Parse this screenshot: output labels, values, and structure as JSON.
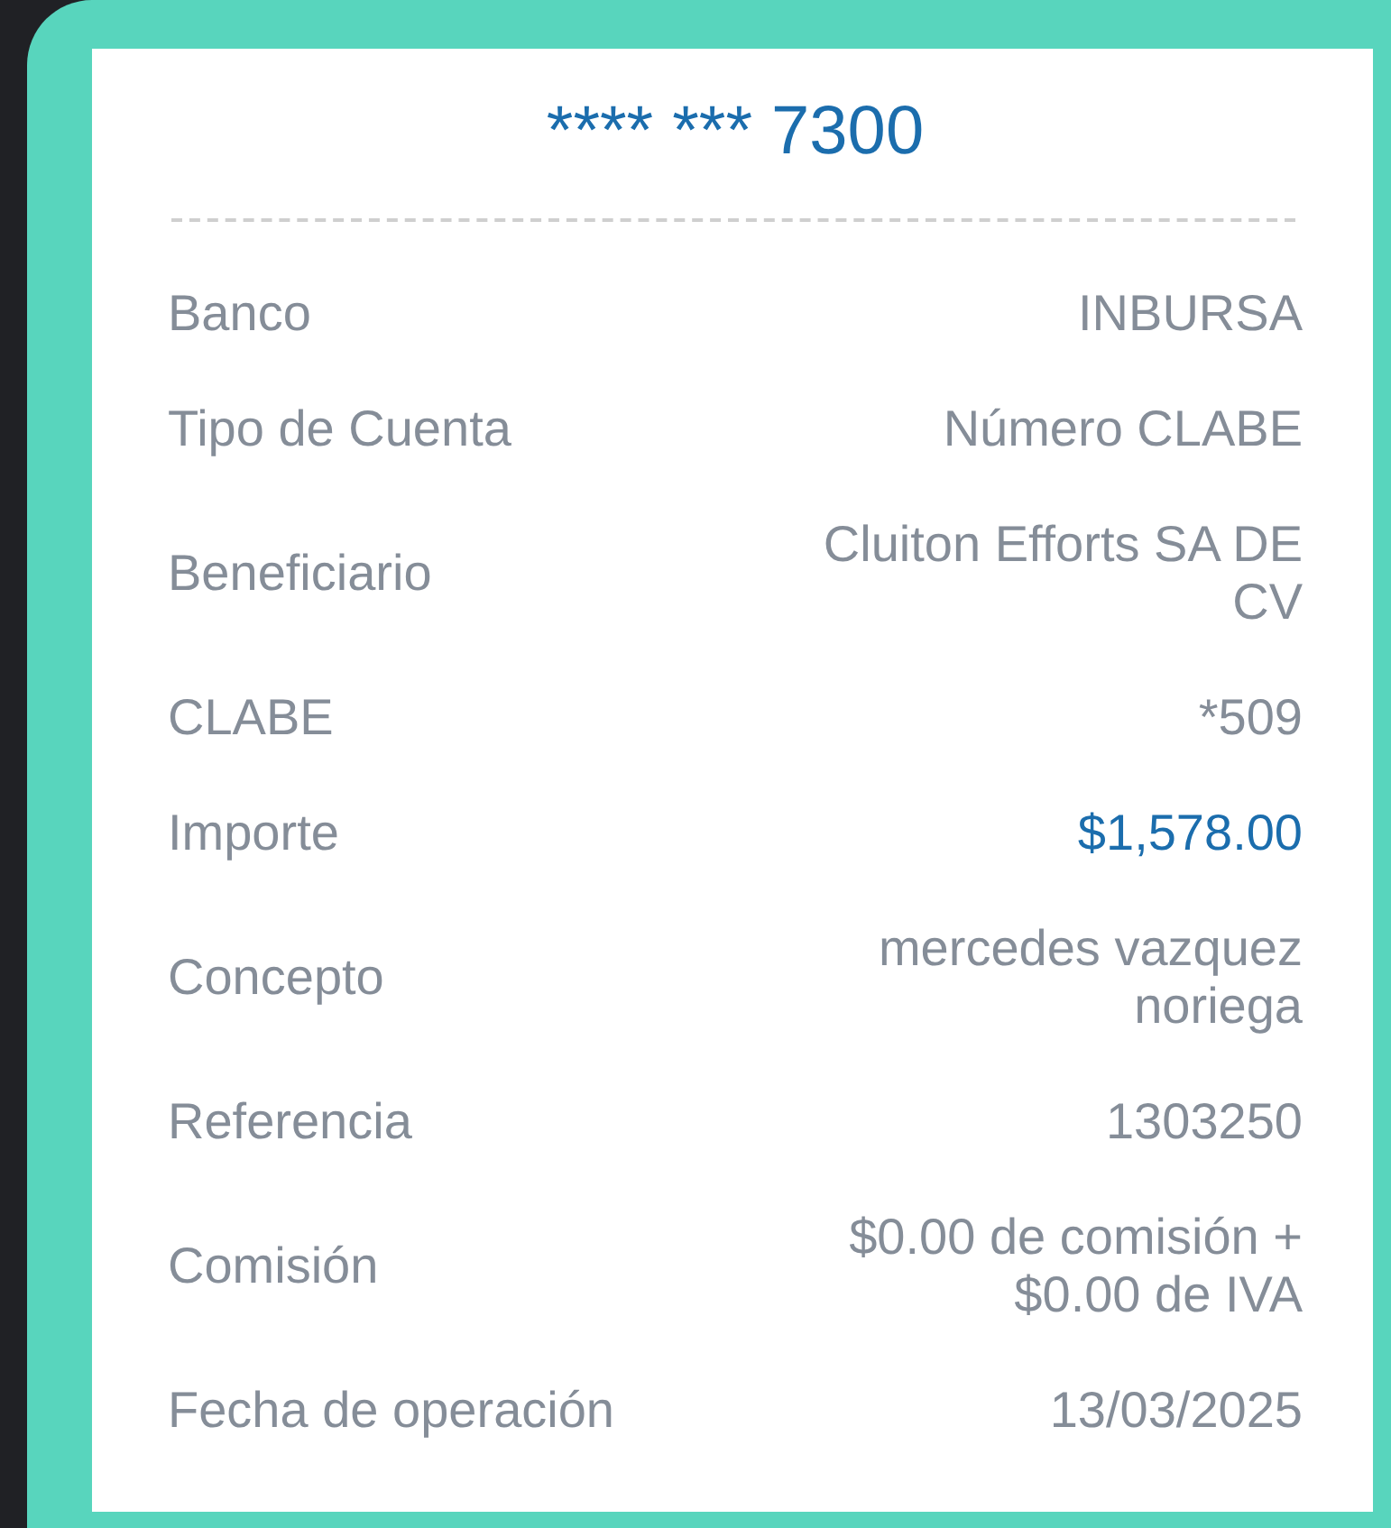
{
  "account": {
    "masked_number": "**** *** 7300"
  },
  "details": [
    {
      "label": "Banco",
      "value": "INBURSA",
      "kind": "text"
    },
    {
      "label": "Tipo de Cuenta",
      "value": "Número CLABE",
      "kind": "text"
    },
    {
      "label": "Beneficiario",
      "value": "Cluiton Efforts SA DE CV",
      "kind": "text"
    },
    {
      "label": "CLABE",
      "value": "*509",
      "kind": "text"
    },
    {
      "label": "Importe",
      "value": "$1,578.00",
      "kind": "amount"
    },
    {
      "label": "Concepto",
      "value": "mercedes vazquez noriega",
      "kind": "text"
    },
    {
      "label": "Referencia",
      "value": "1303250",
      "kind": "text"
    },
    {
      "label": "Comisión",
      "value": "$0.00 de comisión + $0.00 de IVA",
      "kind": "text"
    },
    {
      "label": "Fecha de operación",
      "value": "13/03/2025",
      "kind": "text"
    }
  ]
}
